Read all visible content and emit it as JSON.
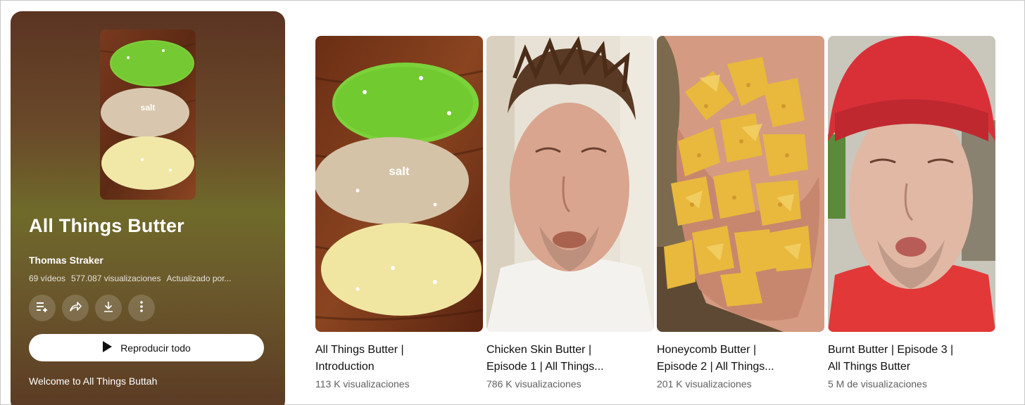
{
  "playlist": {
    "title": "All Things Butter",
    "owner": "Thomas Straker",
    "video_count": "69 vídeos",
    "views": "577.087 visualizaciones",
    "updated": "Actualizado por...",
    "play_all_label": "Reproducir todo",
    "description": "Welcome to All Things Buttah",
    "cover_caption": "salt",
    "actions": [
      "add-to-queue-icon",
      "share-icon",
      "download-icon",
      "more-vert-icon"
    ]
  },
  "videos": [
    {
      "title": "All Things Butter |\nIntroduction",
      "views": "113 K visualizaciones",
      "thumb_caption": "salt"
    },
    {
      "title": "Chicken Skin Butter |\nEpisode 1 | All Things...",
      "views": "786 K visualizaciones"
    },
    {
      "title": "Honeycomb Butter |\nEpisode 2 | All Things...",
      "views": "201 K visualizaciones"
    },
    {
      "title": "Burnt Butter | Episode 3 |\nAll Things Butter",
      "views": "5 M de visualizaciones"
    }
  ]
}
